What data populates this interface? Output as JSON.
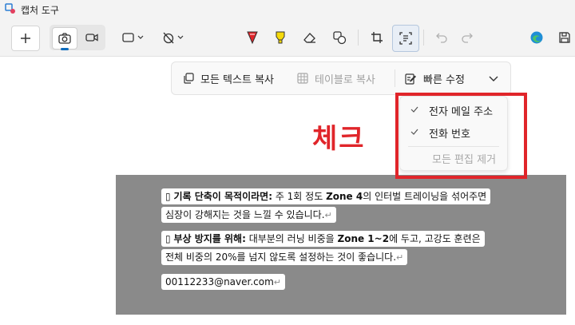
{
  "window": {
    "title": "캡처 도구"
  },
  "toolbar": {
    "icons": [
      "new-icon",
      "camera-icon",
      "video-icon",
      "rectangle-snip-icon",
      "no-timer-icon",
      "pen-icon",
      "highlighter-icon",
      "eraser-icon",
      "shapes-icon",
      "crop-icon",
      "text-actions-icon",
      "undo-icon",
      "redo-icon",
      "edge-icon",
      "save-icon"
    ]
  },
  "text_actions": {
    "copy_all_text": "모든 텍스트 복사",
    "copy_as_table": "테이블로 복사",
    "quick_redact": "빠른 수정"
  },
  "redact_menu": {
    "items": [
      {
        "label": "전자 메일 주소",
        "checked": true
      },
      {
        "label": "전화 번호",
        "checked": true
      }
    ],
    "remove_all": "모든 편집 제거"
  },
  "annotation": {
    "text": "체크",
    "color": "#e0252a"
  },
  "screenshot_text": {
    "line1_bold": "기록 단축이 목적이라면:",
    "line1_a": " 주 1회 정도 ",
    "line1_bold2": "Zone 4",
    "line1_b": "의 인터벌 트레이닝을 섞어주면",
    "line2": "심장이 강해지는 것을 느낄 수 있습니다.",
    "line3_bold": "부상 방지를 위해:",
    "line3_a": " 대부분의 러닝 비중을 ",
    "line3_bold2": "Zone 1~2",
    "line3_b": "에 두고, 고강도 훈련은",
    "line4": "전체 비중의 20%를 넘지 않도록 설정하는 것이 좋습니다.",
    "email": "00112233@naver.com",
    "bullet": "▯",
    "return_mark": "↵"
  },
  "colors": {
    "accent": "#0f6cbd",
    "annotation_red": "#e0252a",
    "screenshot_bg": "#8a8a8a"
  }
}
